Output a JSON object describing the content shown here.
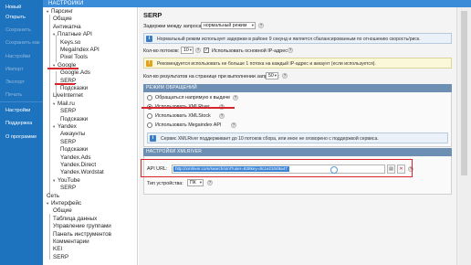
{
  "sidebar": {
    "items": [
      {
        "label": "Новый",
        "dim": false
      },
      {
        "label": "Открыть",
        "dim": false
      },
      {
        "label": "Сохранить",
        "dim": true
      },
      {
        "label": "Сохранить как",
        "dim": true
      },
      {
        "label": "Настройки",
        "dim": true
      },
      {
        "label": "Импорт",
        "dim": true
      },
      {
        "label": "Экспорт",
        "dim": true
      },
      {
        "label": "Печать",
        "dim": true
      }
    ],
    "bottom_items": [
      {
        "label": "Настройки"
      },
      {
        "label": "Поддержка"
      },
      {
        "label": "О программе"
      }
    ]
  },
  "header": {
    "title": "НАСТРОЙКИ"
  },
  "tree": {
    "nodes": [
      {
        "label": "Парсинг",
        "level": 0,
        "toggle": "▾"
      },
      {
        "label": "Общие",
        "level": 1
      },
      {
        "label": "Антикапча",
        "level": 1
      },
      {
        "label": "Платные API",
        "level": 1,
        "toggle": "▾"
      },
      {
        "label": "Keys.so",
        "level": 2
      },
      {
        "label": "MegaIndex API",
        "level": 2
      },
      {
        "label": "Pixel Tools",
        "level": 2
      },
      {
        "label": "Google",
        "level": 1,
        "toggle": "▾"
      },
      {
        "label": "Google.Ads",
        "level": 2
      },
      {
        "label": "SERP",
        "level": 2,
        "selected": true
      },
      {
        "label": "Подсказки",
        "level": 2
      },
      {
        "label": "LiveInternet",
        "level": 1
      },
      {
        "label": "Mail.ru",
        "level": 1,
        "toggle": "▾"
      },
      {
        "label": "SERP",
        "level": 2
      },
      {
        "label": "Подсказки",
        "level": 2
      },
      {
        "label": "Yandex",
        "level": 1,
        "toggle": "▾"
      },
      {
        "label": "Аккаунты",
        "level": 2
      },
      {
        "label": "SERP",
        "level": 2
      },
      {
        "label": "Подсказки",
        "level": 2
      },
      {
        "label": "Yandex.Ads",
        "level": 2
      },
      {
        "label": "Yandex.Direct",
        "level": 2
      },
      {
        "label": "Yandex.Wordstat",
        "level": 2
      },
      {
        "label": "YouTube",
        "level": 1,
        "toggle": "▾"
      },
      {
        "label": "SERP",
        "level": 2
      },
      {
        "label": "Сеть",
        "level": 0
      },
      {
        "label": "Интерфейс",
        "level": 0,
        "toggle": "▾"
      },
      {
        "label": "Общие",
        "level": 1
      },
      {
        "label": "Таблица данных",
        "level": 1
      },
      {
        "label": "Управление группами",
        "level": 1
      },
      {
        "label": "Панель инструментов",
        "level": 1
      },
      {
        "label": "Комментарии",
        "level": 1
      },
      {
        "label": "KEI",
        "level": 1
      },
      {
        "label": "SERP",
        "level": 1
      }
    ]
  },
  "content": {
    "title": "SERP",
    "delay_label": "Задержки между запросами:",
    "delay_value": "нормальный режим",
    "normal_mode_info": "Нормальный режим использует задержки в районе 9 секунд и является сбалансированным по отношению скорость/риск.",
    "threads_label": "Кол-во потоков:",
    "threads_value": "10",
    "use_main_ip_label": "Использовать основной IP-адрес",
    "use_main_ip_checked": true,
    "warn_info": "Рекомендуется использовать не больше 1 потока на каждый IP-адрес и аккаунт (если используется).",
    "results_label": "Кол-во результатов на странице при выполнении запросов:",
    "results_value": "50",
    "mode_group": {
      "title": "РЕЖИМ ОБРАЩЕНИЙ",
      "options": [
        {
          "label": "Обращаться напрямую к выдаче",
          "checked": false
        },
        {
          "label": "Использовать XMLRiver",
          "checked": true
        },
        {
          "label": "Использовать XMLStock",
          "checked": false
        },
        {
          "label": "Использовать Megaindex API",
          "checked": false
        }
      ],
      "info": "Сервис XMLRiver поддерживает до 10 потоков сбора, или иное не оговорено с поддержкой сервиса."
    },
    "xml_group": {
      "title": "НАСТРОЙКИ XMLRIVER",
      "url_label": "API URL:",
      "url_value": "http://xmlriver.com/search/xml?user=828key=8c1e21049a47",
      "device_label": "Тип устройства:",
      "device_value": "ПК"
    }
  },
  "colors": {
    "sidebar": "#1e73be",
    "header": "#3b8cd8",
    "group_header": "#6d8fb3",
    "highlight": "#d8242a"
  }
}
